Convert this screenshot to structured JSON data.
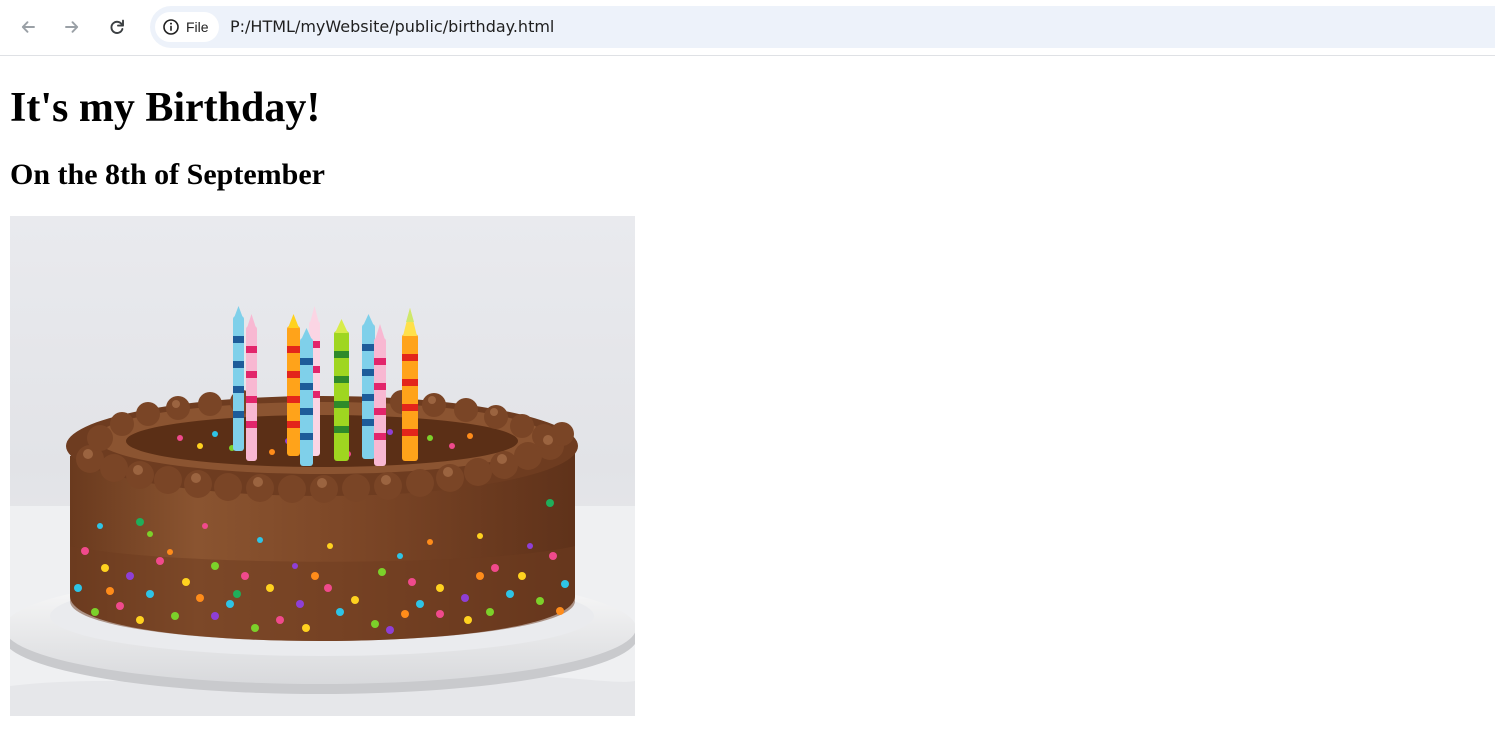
{
  "browser": {
    "site_chip_label": "File",
    "url": "P:/HTML/myWebsite/public/birthday.html",
    "icons": {
      "back": "arrow-left-icon",
      "forward": "arrow-right-icon",
      "reload": "reload-icon",
      "site_info": "info-circle-icon"
    }
  },
  "page": {
    "title": "It's my Birthday!",
    "subtitle": "On the 8th of September",
    "image": {
      "subject": "chocolate-birthday-cake-with-candles"
    }
  },
  "colors": {
    "omnibox_background": "#edf2fa",
    "page_background": "#ffffff",
    "frosting": "#7a4526"
  }
}
